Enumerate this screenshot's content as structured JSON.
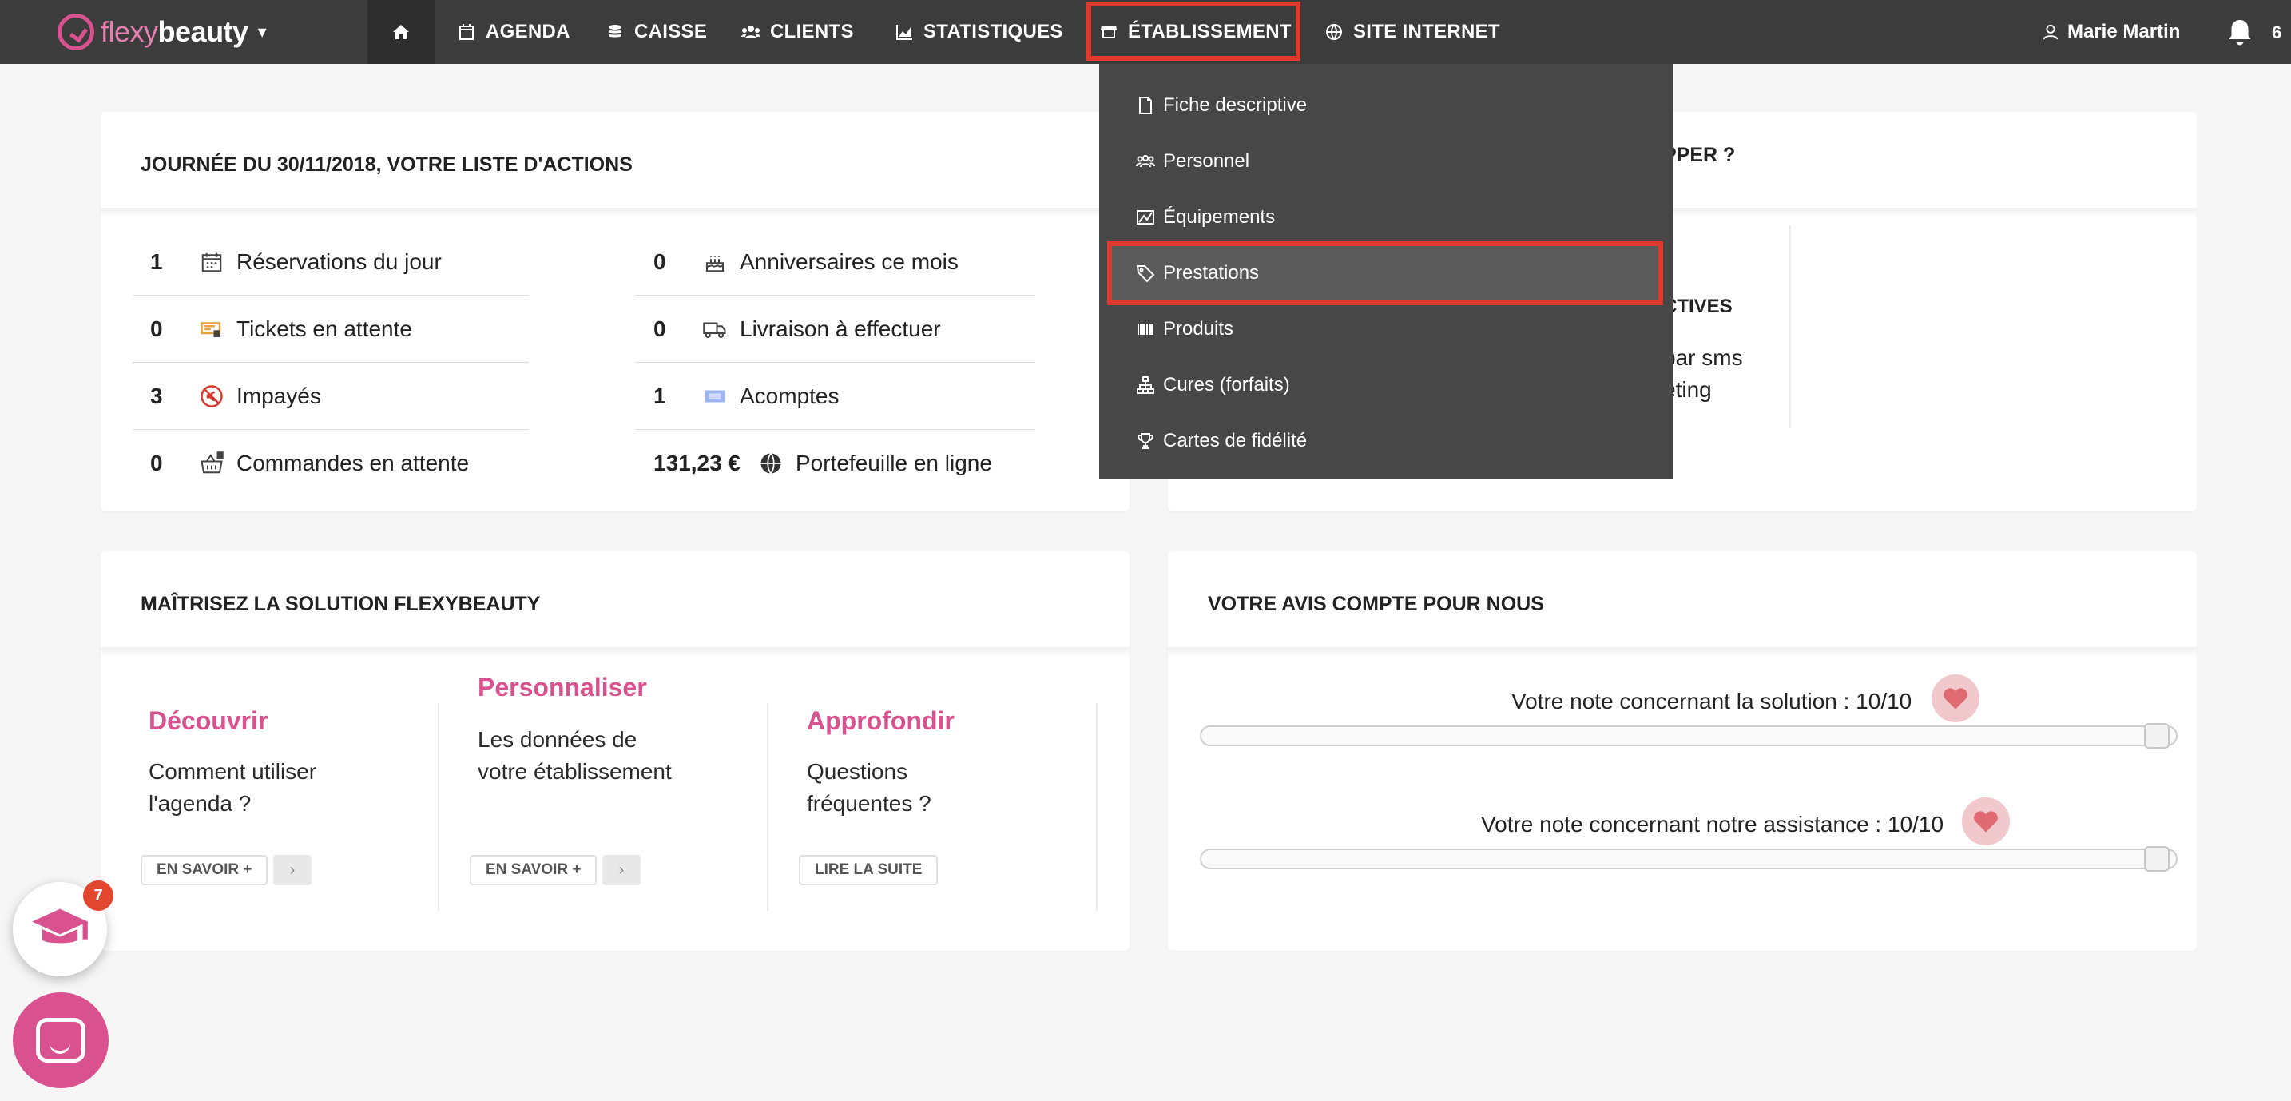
{
  "brand": {
    "name_a": "flexy",
    "name_b": "beauty"
  },
  "nav": {
    "agenda": "AGENDA",
    "caisse": "CAISSE",
    "clients": "CLIENTS",
    "statistiques": "STATISTIQUES",
    "etablissement": "ÉTABLISSEMENT",
    "site": "SITE INTERNET",
    "user": "Marie Martin",
    "notif_count": "6"
  },
  "dropdown": {
    "items": [
      "Fiche descriptive",
      "Personnel",
      "Équipements",
      "Prestations",
      "Produits",
      "Cures (forfaits)",
      "Cartes de fidélité"
    ],
    "active": "Prestations"
  },
  "actions": {
    "title": "JOURNÉE DU 30/11/2018, VOTRE LISTE D'ACTIONS",
    "left": [
      {
        "count": "1",
        "label": "Réservations du jour"
      },
      {
        "count": "0",
        "label": "Tickets en attente"
      },
      {
        "count": "3",
        "label": "Impayés"
      },
      {
        "count": "0",
        "label": "Commandes en attente"
      }
    ],
    "right": [
      {
        "count": "0",
        "label": "Anniversaires ce mois"
      },
      {
        "count": "0",
        "label": "Livraison à effectuer"
      },
      {
        "count": "1",
        "label": "Acomptes"
      },
      {
        "count": "131,23 €",
        "label": "Portefeuille en ligne"
      }
    ]
  },
  "develop": {
    "title_partial": "PPER ?",
    "sub_partial": "CTIVES",
    "line1_partial": "par sms",
    "line2_partial": "eting"
  },
  "learn": {
    "title": "MAÎTRISEZ LA SOLUTION FLEXYBEAUTY",
    "cols": [
      {
        "heading": "Découvrir",
        "text": "Comment utiliser l'agenda ?",
        "button": "EN SAVOIR +"
      },
      {
        "heading": "Personnaliser",
        "text": "Les données de votre établissement",
        "button": "EN SAVOIR +"
      },
      {
        "heading": "Approfondir",
        "text": "Questions fréquentes ?",
        "button": "LIRE LA SUITE"
      }
    ]
  },
  "feedback": {
    "title": "VOTRE AVIS COMPTE POUR NOUS",
    "solution_label": "Votre note concernant la solution : 10/10",
    "solution_value": 10,
    "assistance_label": "Votre note concernant notre assistance : 10/10",
    "assistance_value": 10
  },
  "floating": {
    "edu_badge": "7"
  }
}
